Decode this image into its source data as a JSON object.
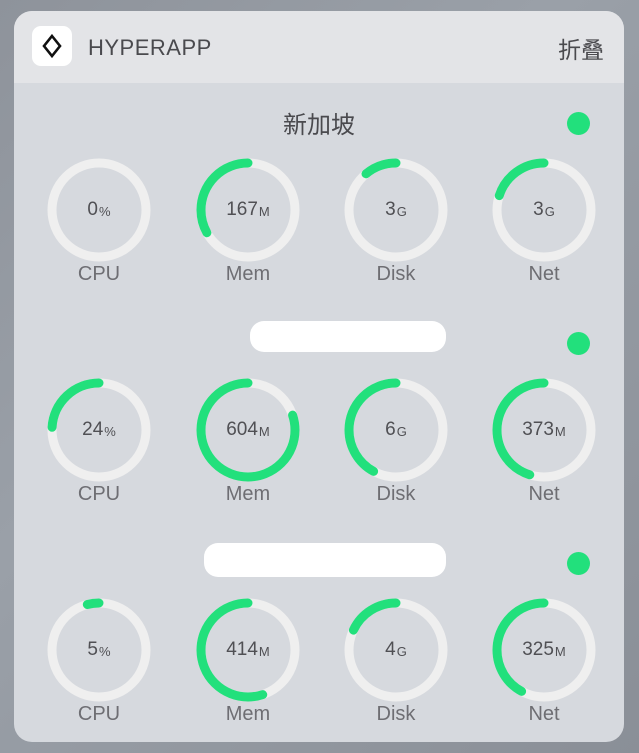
{
  "header": {
    "app_name": "HYPERAPP",
    "collapse_label": "折叠",
    "icon": "diamond-outline-icon"
  },
  "colors": {
    "accent": "#22e07c",
    "ring_track": "#efefef",
    "status_online": "#22e07c"
  },
  "servers": [
    {
      "name": "新加坡",
      "status": "online",
      "metrics": [
        {
          "label": "CPU",
          "value": "0",
          "unit": "%",
          "fill": 0.0
        },
        {
          "label": "Mem",
          "value": "167",
          "unit": "M",
          "fill": 0.33
        },
        {
          "label": "Disk",
          "value": "3",
          "unit": "G",
          "fill": 0.11
        },
        {
          "label": "Net",
          "value": "3",
          "unit": "G",
          "fill": 0.2
        }
      ]
    },
    {
      "name": "",
      "status": "online",
      "metrics": [
        {
          "label": "CPU",
          "value": "24",
          "unit": "%",
          "fill": 0.24
        },
        {
          "label": "Mem",
          "value": "604",
          "unit": "M",
          "fill": 0.8
        },
        {
          "label": "Disk",
          "value": "6",
          "unit": "G",
          "fill": 0.42
        },
        {
          "label": "Net",
          "value": "373",
          "unit": "M",
          "fill": 0.45
        }
      ]
    },
    {
      "name": "",
      "status": "online",
      "metrics": [
        {
          "label": "CPU",
          "value": "5",
          "unit": "%",
          "fill": 0.04
        },
        {
          "label": "Mem",
          "value": "414",
          "unit": "M",
          "fill": 0.55
        },
        {
          "label": "Disk",
          "value": "4",
          "unit": "G",
          "fill": 0.18
        },
        {
          "label": "Net",
          "value": "325",
          "unit": "M",
          "fill": 0.42
        }
      ]
    }
  ]
}
